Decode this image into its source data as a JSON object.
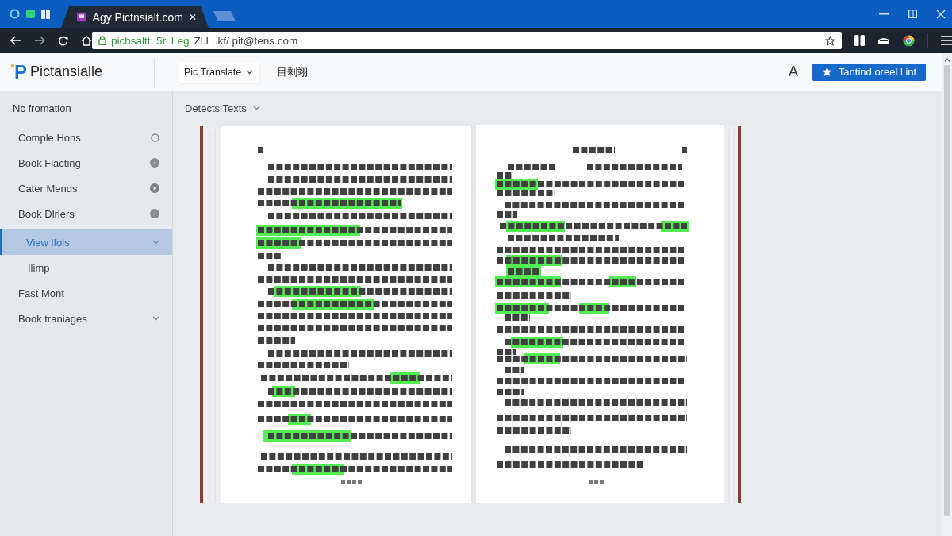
{
  "browser": {
    "tab": {
      "title": "Agy Pictnsialt.com"
    },
    "address": {
      "secure_part": "pichsaltt: 5ri Leg",
      "path": "Zl.L..kf/ pit@tens.com"
    }
  },
  "app": {
    "logo_mark": "P",
    "name": "Pictansialle",
    "mode_menu": "Pic Translate",
    "nav_link": "目剰翊",
    "font_button": "A",
    "primary_button": "Tantind oreel l int"
  },
  "sidebar": {
    "heading": "Nc fromation",
    "items": [
      {
        "label": "Comple Hons",
        "kind": "ring",
        "selected": false
      },
      {
        "label": "Book Flacting",
        "kind": "dot",
        "selected": false
      },
      {
        "label": "Cater Mends",
        "kind": "play",
        "selected": false
      },
      {
        "label": "Book Dlrlers",
        "kind": "dot",
        "selected": false
      },
      {
        "label": "View lfols",
        "kind": "menu",
        "selected": true,
        "children": [
          {
            "label": "Ilimp",
            "selected": false
          }
        ]
      },
      {
        "label": "Fast Mont",
        "kind": "plain",
        "selected": false
      },
      {
        "label": "Book traniages",
        "kind": "menu",
        "selected": false
      }
    ]
  },
  "toolbar": {
    "dropdown": "Detects Texts"
  }
}
